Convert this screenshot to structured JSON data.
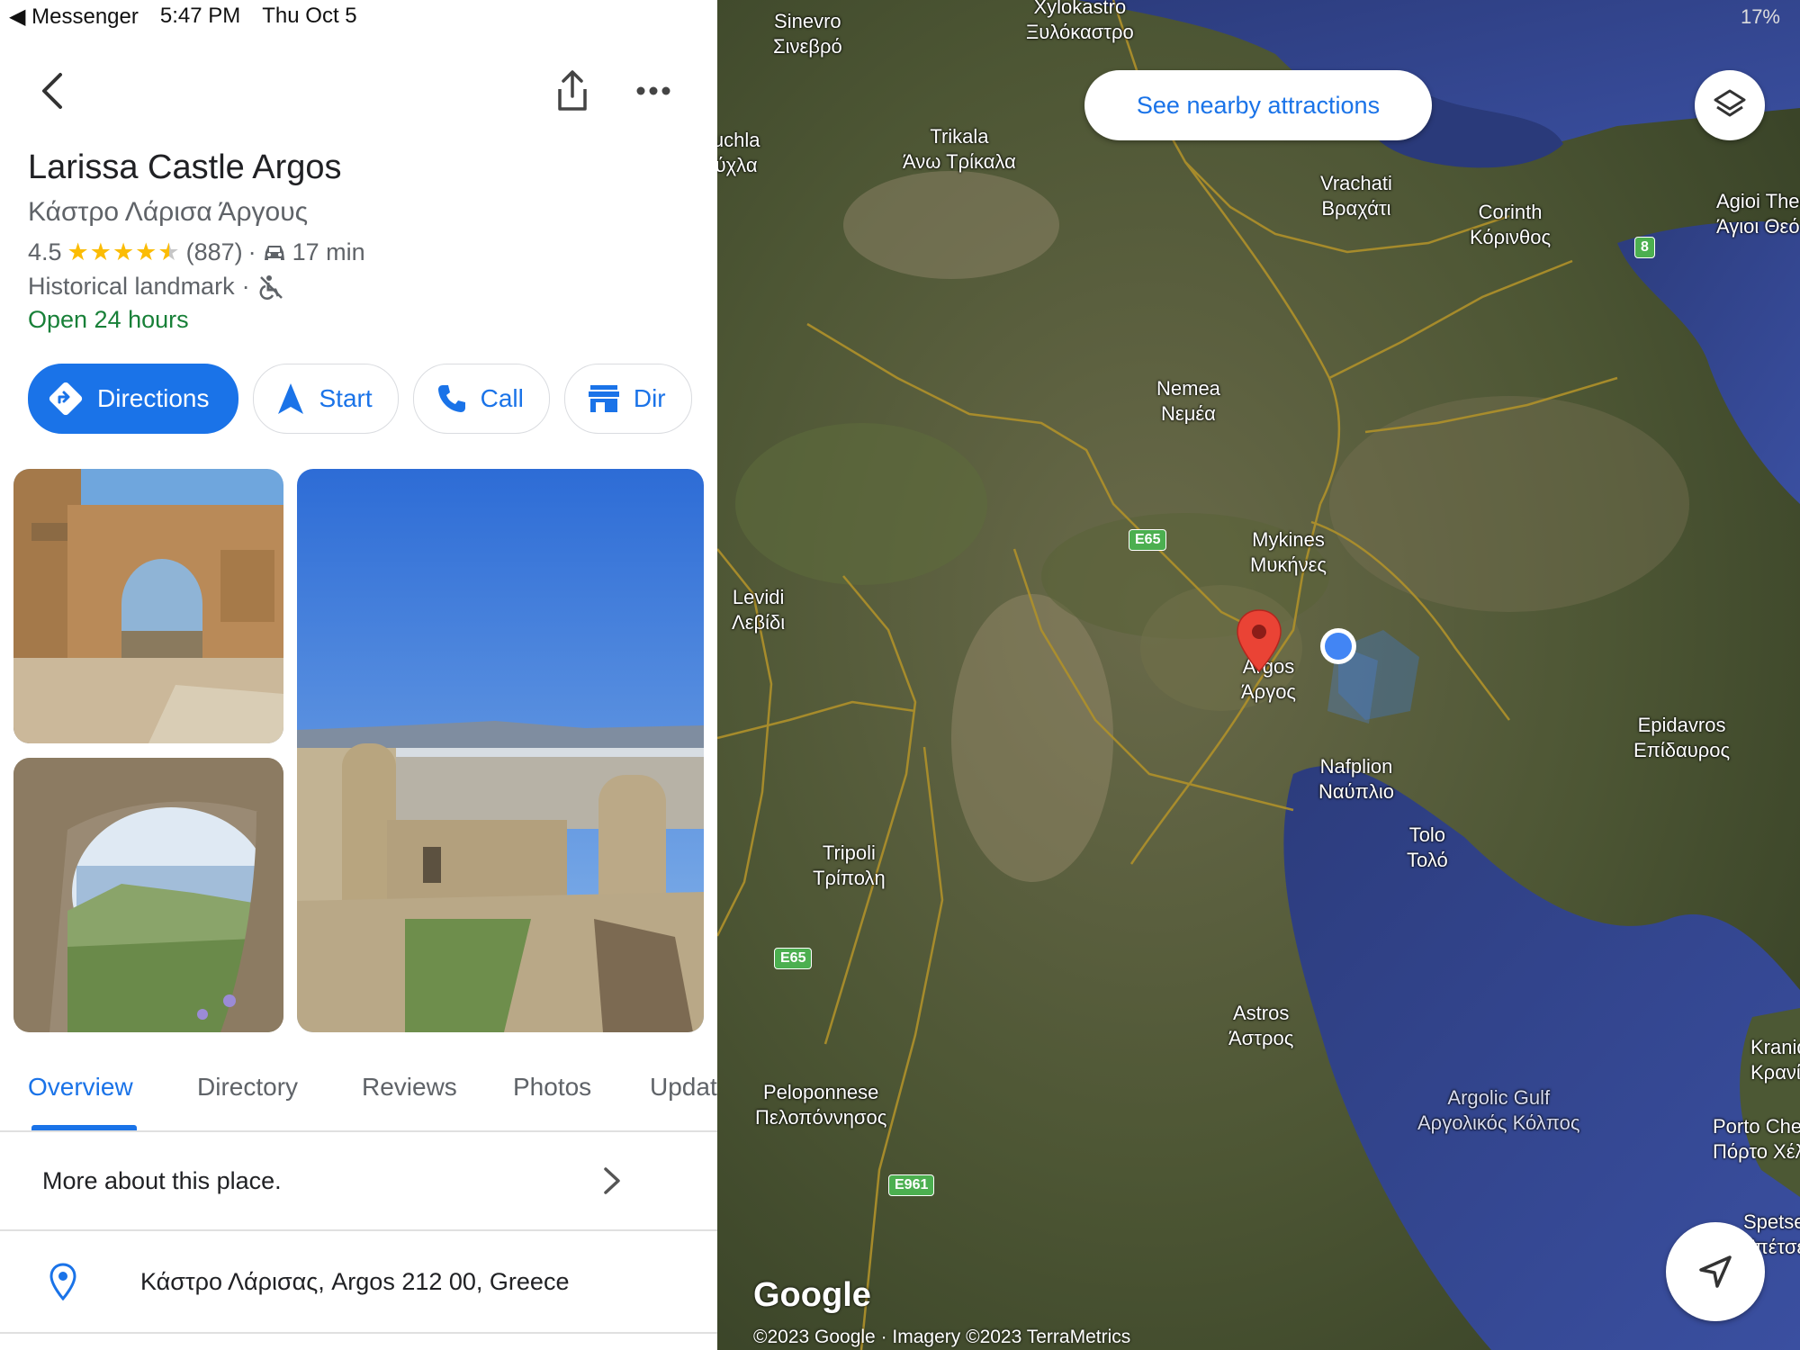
{
  "status_bar": {
    "back_app": "Messenger",
    "time": "5:47 PM",
    "date": "Thu Oct 5",
    "battery": "17%"
  },
  "place": {
    "name": "Larissa Castle Argos",
    "local_name": "Κάστρο Λάρισα Άργους",
    "rating": "4.5",
    "rating_value": 4.5,
    "review_count": "(887)",
    "drive_time": "17 min",
    "category": "Historical landmark",
    "hours": "Open 24 hours",
    "address": "Κάστρο Λάρισας, Argos 212 00, Greece"
  },
  "actions": [
    {
      "label": "Directions",
      "icon": "directions-icon"
    },
    {
      "label": "Start",
      "icon": "navigation-arrow-icon"
    },
    {
      "label": "Call",
      "icon": "phone-icon"
    },
    {
      "label": "Dir",
      "icon": "store-icon"
    }
  ],
  "tabs": [
    "Overview",
    "Directory",
    "Reviews",
    "Photos",
    "Updat"
  ],
  "more_about": "More about this place.",
  "map": {
    "nearby_button": "See nearby attractions",
    "labels": [
      "Xylokastro",
      "Ξυλόκαστρο",
      "Sinevro",
      "Σινεβρό",
      "Trikala",
      "Άνω Τρίκαλα",
      "Kouchla",
      "Κούχλα",
      "Vrachati",
      "Βραχάτι",
      "Corinth",
      "Κόρινθος",
      "Agioi Theodoroi",
      "Άγιοι Θεόδωροι",
      "Nemea",
      "Νεμέα",
      "Mykines",
      "Μυκήνες",
      "Levidi",
      "Λεβίδι",
      "Argos",
      "Άργος",
      "Nafplion",
      "Ναύπλιο",
      "Tolo",
      "Τολό",
      "Epidavros",
      "Επίδαυρος",
      "Tripoli",
      "Τρίπολη",
      "Astros",
      "Άστρος",
      "Peloponnese",
      "Πελοπόννησος",
      "Argolic Gulf",
      "Αργολικός Κόλπος",
      "Kranidi",
      "Κρανίδι",
      "Porto Cheli",
      "Πόρτο Χέλι",
      "Spetses",
      "Σπέτσες"
    ],
    "shields": [
      "E65",
      "E65",
      "E961",
      "8"
    ],
    "logo": "Google",
    "attribution": "©2023 Google · Imagery ©2023 TerraMetrics"
  }
}
